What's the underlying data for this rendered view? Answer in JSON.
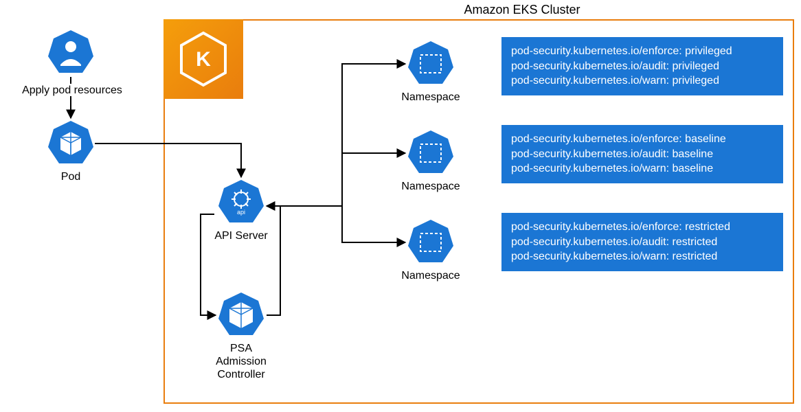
{
  "title": "Amazon EKS Cluster",
  "user": {
    "label": "Apply pod resources"
  },
  "pod": {
    "label": "Pod"
  },
  "apiServer": {
    "label": "API Server"
  },
  "psa": {
    "label": "PSA\nAdmission\nController"
  },
  "namespaces": {
    "ns1": {
      "label": "Namespace"
    },
    "ns2": {
      "label": "Namespace"
    },
    "ns3": {
      "label": "Namespace"
    }
  },
  "policies": {
    "privileged": {
      "line1": "pod-security.kubernetes.io/enforce: privileged",
      "line2": "pod-security.kubernetes.io/audit: privileged",
      "line3": "pod-security.kubernetes.io/warn: privileged"
    },
    "baseline": {
      "line1": "pod-security.kubernetes.io/enforce: baseline",
      "line2": "pod-security.kubernetes.io/audit: baseline",
      "line3": "pod-security.kubernetes.io/warn: baseline"
    },
    "restricted": {
      "line1": "pod-security.kubernetes.io/enforce: restricted",
      "line2": "pod-security.kubernetes.io/audit: restricted",
      "line3": "pod-security.kubernetes.io/warn: restricted"
    }
  },
  "colors": {
    "k8sBlue": "#1b76d4",
    "eksOrange": "#e97d0d",
    "clusterBorder": "#e97d0d",
    "boxBg": "#1b76d4"
  }
}
